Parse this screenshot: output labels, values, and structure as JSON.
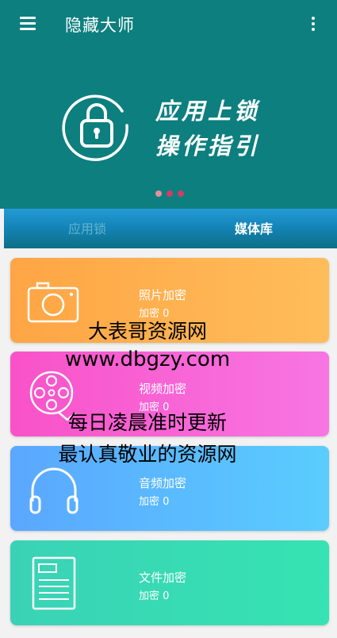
{
  "toolbar": {
    "title": "隐藏大师"
  },
  "banner": {
    "line1": "应用上锁",
    "line2": "操作指引",
    "dots": [
      "#e8909a",
      "#d43c66",
      "#d43c66"
    ]
  },
  "tabs": [
    {
      "label": "应用锁",
      "selected": false
    },
    {
      "label": "媒体库",
      "selected": true
    }
  ],
  "cards": [
    {
      "name": "照片加密",
      "count": "加密 0",
      "icon": "camera-icon"
    },
    {
      "name": "视频加密",
      "count": "加密 0",
      "icon": "film-reel-icon"
    },
    {
      "name": "音频加密",
      "count": "加密 0",
      "icon": "headphones-icon"
    },
    {
      "name": "文件加密",
      "count": "加密 0",
      "icon": "document-icon"
    }
  ],
  "watermark": {
    "line1": "大表哥资源网",
    "line2": "www.dbgzy.com",
    "line3": "每日凌晨准时更新",
    "line4": "最认真敬业的资源网"
  },
  "colors": {
    "primary": "#0d7f7f",
    "tab_bar": "#1485b8",
    "photo_card": "#ffa545",
    "video_card": "#f952c8",
    "audio_card": "#5aa7ff",
    "file_card": "#3ad2b6"
  }
}
